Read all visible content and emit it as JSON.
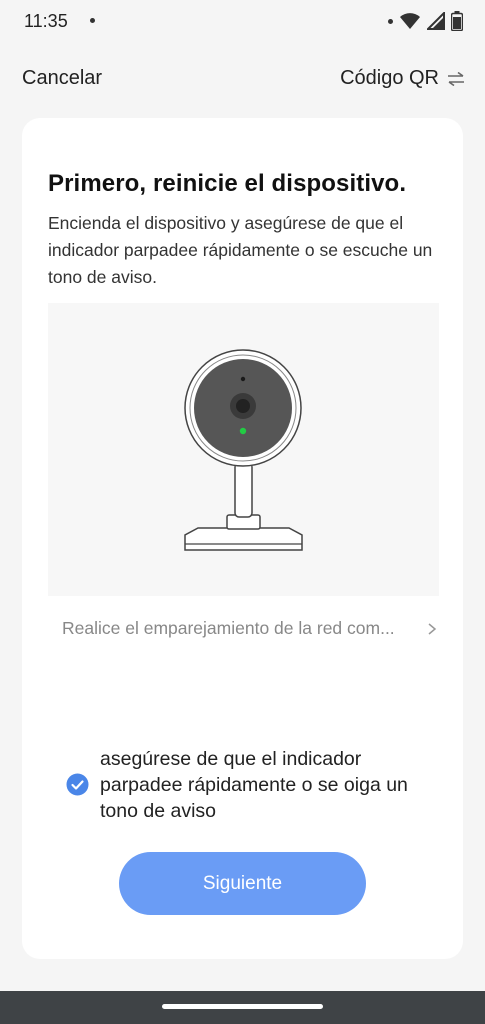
{
  "status_bar": {
    "time": "11:35",
    "icons": [
      "notification-dot-icon",
      "wifi-icon",
      "cellular-signal-icon",
      "battery-icon"
    ]
  },
  "nav": {
    "cancel_label": "Cancelar",
    "qr_label": "Código QR",
    "qr_icon": "swap-arrows-icon"
  },
  "content": {
    "title": "Primero, reinicie el dispositivo.",
    "description": "Encienda el dispositivo y asegúrese de que el indicador parpadee rápidamente o se escuche un tono de aviso.",
    "illustration": "security-camera-illustration",
    "pairing_link": "Realice el emparejamiento de la red com...",
    "confirm_checkbox": {
      "label": "asegúrese de que el indicador parpadee rápidamente o se oiga un tono de aviso",
      "checked": true
    },
    "next_button": "Siguiente"
  },
  "colors": {
    "accent": "#6a9cf5",
    "checkbox": "#4a86e8",
    "indicator_led": "#22cc44",
    "background": "#f5f5f5",
    "card": "#ffffff",
    "nav_bar": "#3f4346"
  }
}
